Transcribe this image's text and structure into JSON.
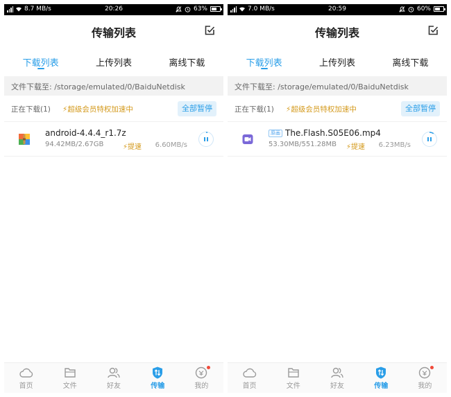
{
  "colors": {
    "accent": "#2a9ee8",
    "vip_gold": "#d49a1d",
    "badge_red": "#f04a3a"
  },
  "screens": [
    {
      "status": {
        "net_speed": "8.7 MB/s",
        "time": "20:26",
        "battery": "63%",
        "battery_level": 0.63
      },
      "header": {
        "title": "传输列表",
        "edit_icon": "edit-check-icon"
      },
      "tabs": [
        {
          "label": "下载列表",
          "active": true
        },
        {
          "label": "上传列表",
          "active": false
        },
        {
          "label": "离线下载",
          "active": false
        }
      ],
      "path": "文件下载至: /storage/emulated/0/BaiduNetdisk",
      "downloading": {
        "count_label": "正在下载(1)",
        "vip_label": "超级会员特权加速中",
        "pause_all": "全部暂停"
      },
      "items": [
        {
          "name": "android-4.4.4_r1.7z",
          "tag": "",
          "size": "94.42MB/2.67GB",
          "speedup": "提速",
          "rate": "6.60MB/s",
          "icon": "archive-file-icon",
          "progress": 0.034
        }
      ],
      "nav": [
        {
          "label": "首页",
          "icon": "home-cloud-icon",
          "active": false
        },
        {
          "label": "文件",
          "icon": "folder-icon",
          "active": false
        },
        {
          "label": "好友",
          "icon": "friends-icon",
          "active": false
        },
        {
          "label": "传输",
          "icon": "transfer-shield-icon",
          "active": true
        },
        {
          "label": "我的",
          "icon": "profile-icon",
          "active": false
        }
      ]
    },
    {
      "status": {
        "net_speed": "7.0 MB/s",
        "time": "20:59",
        "battery": "60%",
        "battery_level": 0.6
      },
      "header": {
        "title": "传输列表",
        "edit_icon": "edit-check-icon"
      },
      "tabs": [
        {
          "label": "下载列表",
          "active": true
        },
        {
          "label": "上传列表",
          "active": false
        },
        {
          "label": "离线下载",
          "active": false
        }
      ],
      "path": "文件下载至: /storage/emulated/0/BaiduNetdisk",
      "downloading": {
        "count_label": "正在下载(1)",
        "vip_label": "超级会员特权加速中",
        "pause_all": "全部暂停"
      },
      "items": [
        {
          "name": "The.Flash.S05E06.mp4",
          "tag": "原画",
          "size": "53.30MB/551.28MB",
          "speedup": "提速",
          "rate": "6.23MB/s",
          "icon": "video-file-icon",
          "progress": 0.097
        }
      ],
      "nav": [
        {
          "label": "首页",
          "icon": "home-cloud-icon",
          "active": false
        },
        {
          "label": "文件",
          "icon": "folder-icon",
          "active": false
        },
        {
          "label": "好友",
          "icon": "friends-icon",
          "active": false
        },
        {
          "label": "传输",
          "icon": "transfer-shield-icon",
          "active": true
        },
        {
          "label": "我的",
          "icon": "profile-icon",
          "active": false
        }
      ]
    }
  ]
}
